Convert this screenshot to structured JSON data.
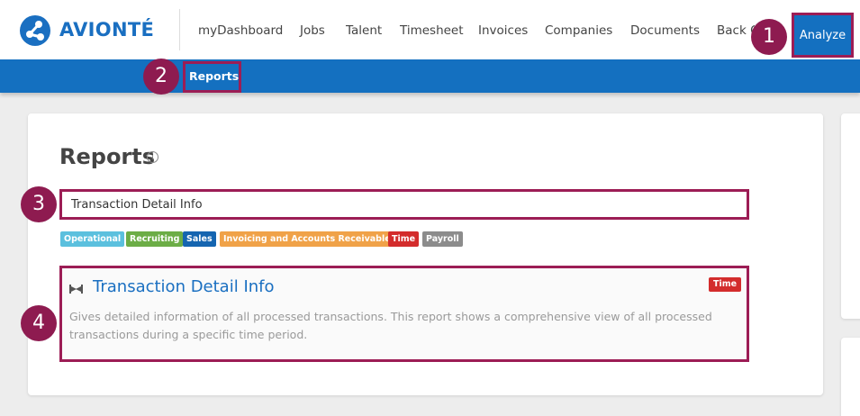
{
  "brand": {
    "name": "AVIONTÉ",
    "color": "#1a6fc1"
  },
  "topnav": {
    "items": [
      "myDashboard",
      "Jobs",
      "Talent",
      "Timesheet",
      "Invoices",
      "Companies",
      "Documents"
    ],
    "truncated_item": "Back Office",
    "active_item": "Analyze"
  },
  "subnav": {
    "active_item": "Reports"
  },
  "page": {
    "title": "Reports",
    "info_icon": "info-icon"
  },
  "search": {
    "value": "Transaction Detail Info",
    "placeholder": ""
  },
  "tags": [
    {
      "label": "Operational",
      "color": "#5bc0de"
    },
    {
      "label": "Recruiting",
      "color": "#6cad46"
    },
    {
      "label": "Sales",
      "color": "#1565b0"
    },
    {
      "label": "Invoicing and Accounts Receivable",
      "color": "#f0a248"
    },
    {
      "label": "Time",
      "color": "#d32c2c"
    },
    {
      "label": "Payroll",
      "color": "#8c8c8c"
    }
  ],
  "result": {
    "title": "Transaction Detail Info",
    "badge": "Time",
    "description": "Gives detailed information of all processed transactions. This report shows a comprehensive view of all processed transactions during a specific time period."
  },
  "callouts": [
    "1",
    "2",
    "3",
    "4"
  ],
  "colors": {
    "primary": "#1470c0",
    "callout": "#8e1b50"
  }
}
